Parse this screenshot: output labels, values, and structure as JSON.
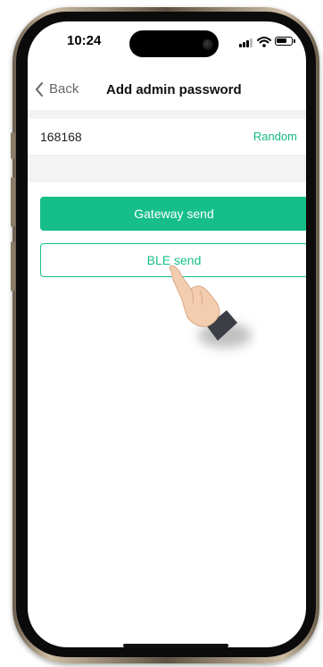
{
  "status_bar": {
    "time": "10:24"
  },
  "nav": {
    "back_label": "Back",
    "title": "Add admin password"
  },
  "password_row": {
    "value": "168168",
    "random_label": "Random"
  },
  "actions": {
    "gateway_send_label": "Gateway send",
    "ble_send_label": "BLE send"
  },
  "colors": {
    "accent": "#16bf8a"
  },
  "icons": {
    "back": "chevron-left-icon",
    "signal": "cellular-signal-icon",
    "wifi": "wifi-icon",
    "battery": "battery-icon",
    "pointer": "hand-pointer-icon"
  }
}
